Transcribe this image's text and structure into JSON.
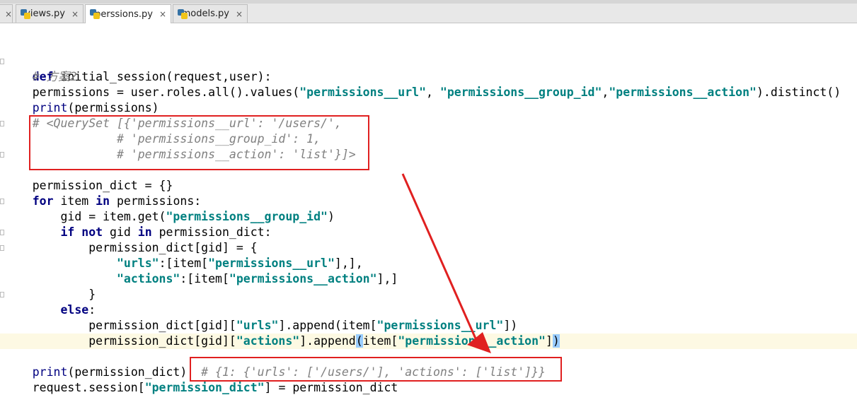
{
  "tabs": [
    {
      "label": "views.py",
      "close": "×"
    },
    {
      "label": "perssions.py",
      "close": "×"
    },
    {
      "label": "models.py",
      "close": "×"
    }
  ],
  "leading_tab_close": "×",
  "code": {
    "l1_kw": "def",
    "l1_rest": " initial_session(request,user):",
    "l2": "    # 方案2",
    "l3_a": "    permissions = user.roles.all().values(",
    "l3_s1": "\"permissions__url\"",
    "l3_b": ", ",
    "l3_s2": "\"permissions__group_id\"",
    "l3_c": ",",
    "l3_s3": "\"permissions__action\"",
    "l3_d": ").distinct()",
    "l4_a": "    ",
    "l4_fn": "print",
    "l4_b": "(permissions)",
    "l5": "    # <QuerySet [{'permissions__url': '/users/',",
    "l6": "                # 'permissions__group_id': 1,",
    "l7": "                # 'permissions__action': 'list'}]>",
    "l8": "",
    "l9": "    permission_dict = {}",
    "l10_a": "    ",
    "l10_for": "for",
    "l10_b": " item ",
    "l10_in": "in",
    "l10_c": " permissions:",
    "l11_a": "        gid = item.get(",
    "l11_s": "\"permissions__group_id\"",
    "l11_b": ")",
    "l12_a": "        ",
    "l12_if": "if",
    "l12_sp1": " ",
    "l12_not": "not",
    "l12_b": " gid ",
    "l12_in": "in",
    "l12_c": " permission_dict:",
    "l13": "            permission_dict[gid] = {",
    "l14_a": "                ",
    "l14_s1": "\"urls\"",
    "l14_b": ":[item[",
    "l14_s2": "\"permissions__url\"",
    "l14_c": "],],",
    "l15_a": "                ",
    "l15_s1": "\"actions\"",
    "l15_b": ":[item[",
    "l15_s2": "\"permissions__action\"",
    "l15_c": "],]",
    "l16": "            }",
    "l17_a": "        ",
    "l17_else": "else",
    "l17_b": ":",
    "l18_a": "            permission_dict[gid][",
    "l18_s1": "\"urls\"",
    "l18_b": "].append(item[",
    "l18_s2": "\"permissions__url\"",
    "l18_c": "])",
    "l19_a": "            permission_dict[gid][",
    "l19_s1": "\"actions\"",
    "l19_b": "].append",
    "l19_p": "(",
    "l19_c": "item[",
    "l19_s2": "\"permissions__action\"",
    "l19_d": "]",
    "l19_p2": ")",
    "l20": "",
    "l21_a": "    ",
    "l21_fn": "print",
    "l21_b": "(permission_dict) ",
    "l21_cmt": " # {1: {'urls': ['/users/'], 'actions': ['list']}}",
    "l22_a": "    request.session[",
    "l22_s": "\"permission_dict\"",
    "l22_b": "] = permission_dict"
  },
  "colors": {
    "annotation": "#e02020",
    "keyword": "#000080",
    "string": "#008080",
    "comment": "#808080",
    "highlight_line": "#fdf9e3"
  }
}
